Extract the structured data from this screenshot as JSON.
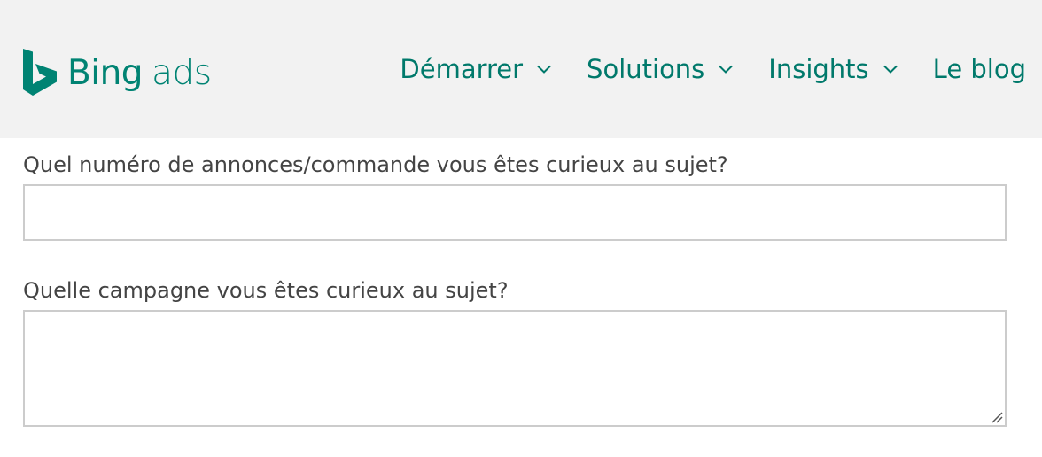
{
  "header": {
    "logo": {
      "brand": "Bing",
      "product": "ads",
      "icon": "bing-b-logo"
    },
    "nav": [
      {
        "label": "Démarrer",
        "has_dropdown": true,
        "icon": "chevron-down-icon"
      },
      {
        "label": "Solutions",
        "has_dropdown": true,
        "icon": "chevron-down-icon"
      },
      {
        "label": "Insights",
        "has_dropdown": true,
        "icon": "chevron-down-icon"
      },
      {
        "label": "Le blog",
        "has_dropdown": false
      }
    ]
  },
  "form": {
    "order_number": {
      "label": "Quel numéro de annonces/commande vous êtes curieux au sujet?",
      "value": ""
    },
    "campaign": {
      "label": "Quelle campagne vous êtes curieux au sujet?",
      "value": "",
      "icon": "resize-handle-icon"
    }
  },
  "colors": {
    "brand": "#008373",
    "nav_text": "#00796b",
    "header_bg": "#f2f2f2",
    "label_text": "#444444",
    "input_border": "#cccccc"
  }
}
